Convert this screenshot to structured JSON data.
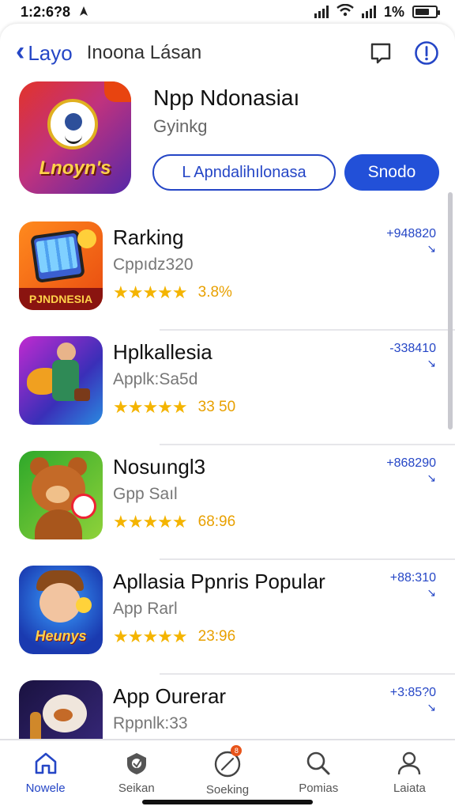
{
  "status_bar": {
    "time": "1:2:6?8",
    "battery": "1%"
  },
  "nav": {
    "back_label": "Layo",
    "title": "Inoona Lásan"
  },
  "featured": {
    "name": "Npp Ndonasiaı",
    "subtitle": "Gyinkg",
    "icon_text": "Lnoyn's",
    "secondary_button": "L Apndalihılonasa",
    "primary_button": "Snodo"
  },
  "apps": [
    {
      "name": "Rarking",
      "subtitle": "Cppıdz320",
      "rating": "3.8%",
      "meta": "+948820",
      "icon_text": "PJNDNESIA"
    },
    {
      "name": "Hplkallesia",
      "subtitle": "Applk:Sa5d",
      "rating": "33 50",
      "meta": "-338410"
    },
    {
      "name": "Nosuıngl3",
      "subtitle": "Gpp Saıl",
      "rating": "68:96",
      "meta": "+868290"
    },
    {
      "name": "Apllasia Ppnris Popular",
      "subtitle": "App Rarl",
      "rating": "23:96",
      "meta": "+88:310",
      "icon_text": "Heunys"
    },
    {
      "name": "App Ourerar",
      "subtitle": "Rppnlk:33",
      "rating": "",
      "meta": "+3:85?0"
    }
  ],
  "tabs": [
    {
      "label": "Nowele"
    },
    {
      "label": "Seikan"
    },
    {
      "label": "Soeking",
      "badge": "8"
    },
    {
      "label": "Pomias"
    },
    {
      "label": "Laiata"
    }
  ],
  "colors": {
    "accent": "#2546c6",
    "primary_button": "#2250d8",
    "star": "#f4b400"
  }
}
